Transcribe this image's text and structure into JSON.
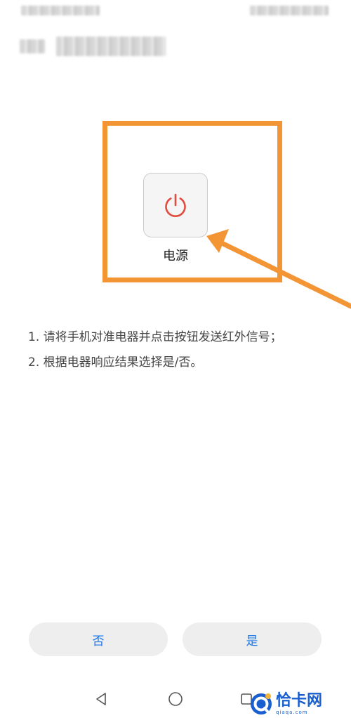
{
  "device": {
    "power_label": "电源",
    "power_icon": "power-icon"
  },
  "instructions": [
    "1. 请将手机对准电器并点击按钮发送红外信号；",
    "2. 根据电器响应结果选择是/否。"
  ],
  "actions": {
    "no_label": "否",
    "yes_label": "是"
  },
  "navigation": {
    "back_icon": "back-triangle-icon",
    "home_icon": "home-circle-icon",
    "recents_icon": "recents-square-icon"
  },
  "watermark": {
    "name": "恰卡网",
    "domain": "qiaqa.com"
  },
  "colors": {
    "highlight": "#f39435",
    "power_icon": "#e24b3f",
    "action_text": "#1d77e6",
    "watermark": "#1a5fcf"
  }
}
